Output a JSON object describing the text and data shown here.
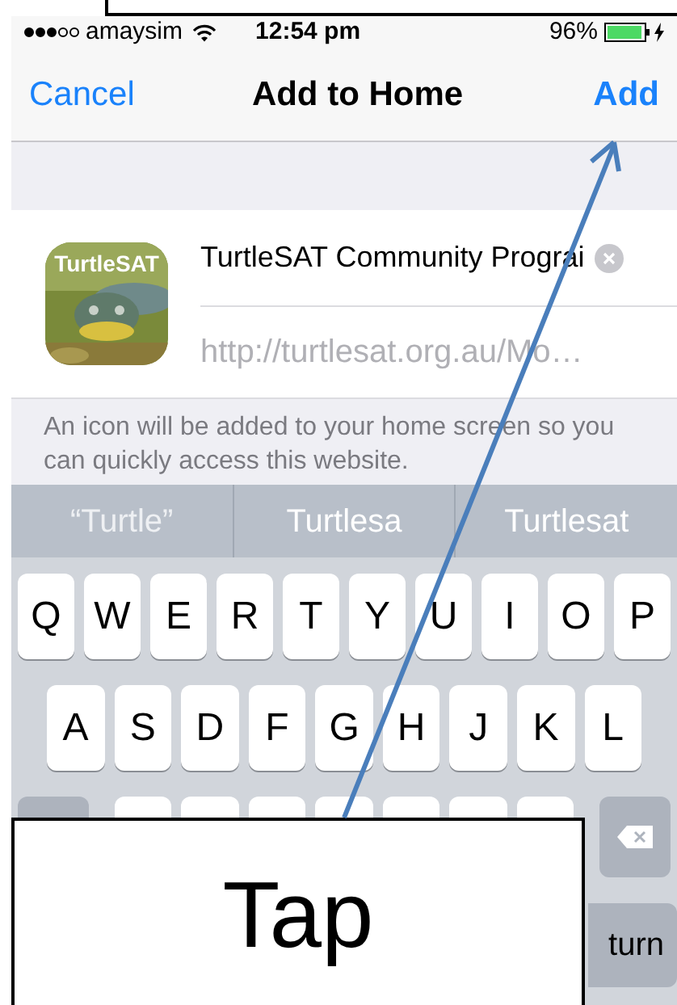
{
  "status_bar": {
    "carrier": "amaysim",
    "time": "12:54 pm",
    "battery": "96%"
  },
  "nav": {
    "cancel": "Cancel",
    "title": "Add to Home",
    "add": "Add"
  },
  "bookmark": {
    "icon_label": "TurtleSAT",
    "name": "TurtleSAT Community Prograi",
    "url": "http://turtlesat.org.au/Mo…"
  },
  "note": "An icon will be added to your home screen so you can quickly access this website.",
  "suggestions": [
    "“Turtle”",
    "Turtlesa",
    "Turtlesat"
  ],
  "keyboard": {
    "rows": [
      [
        "Q",
        "W",
        "E",
        "R",
        "T",
        "Y",
        "U",
        "I",
        "O",
        "P"
      ],
      [
        "A",
        "S",
        "D",
        "F",
        "G",
        "H",
        "J",
        "K",
        "L"
      ]
    ],
    "return_key": "turn"
  },
  "annotation": {
    "label": "Tap"
  }
}
